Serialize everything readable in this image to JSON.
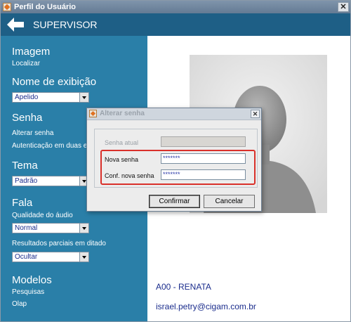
{
  "window": {
    "title": "Perfil do Usuário"
  },
  "header": {
    "title": "SUPERVISOR",
    "back_icon": "arrow-left-icon"
  },
  "sidebar": {
    "imagem": {
      "heading": "Imagem",
      "action": "Localizar"
    },
    "nome": {
      "heading": "Nome de exibição",
      "selected": "Apelido"
    },
    "senha": {
      "heading": "Senha",
      "alterar": "Alterar senha",
      "autenticacao": "Autenticação em duas e"
    },
    "tema": {
      "heading": "Tema",
      "selected": "Padrão"
    },
    "fala": {
      "heading": "Fala",
      "qualidade_label": "Qualidade do áudio",
      "qualidade_selected": "Normal",
      "parciais_label": "Resultados parciais em ditado",
      "parciais_selected": "Ocultar"
    },
    "modelos": {
      "heading": "Modelos",
      "items": [
        "Pesquisas",
        "Olap"
      ]
    }
  },
  "profile": {
    "name": "A00 - RENATA",
    "email": "israel.petry@cigam.com.br",
    "photo_icon": "user-silhouette-icon"
  },
  "dialog": {
    "title": "Alterar senha",
    "senha_atual_label": "Senha atual",
    "senha_atual_value": "",
    "nova_senha_label": "Nova senha",
    "nova_senha_value": "*******",
    "conf_label": "Conf. nova senha",
    "conf_value": "*******",
    "confirm_label": "Confirmar",
    "cancel_label": "Cancelar"
  },
  "colors": {
    "header": "#1e5f86",
    "sidebar": "#2a7fa8",
    "highlight": "#d9302a",
    "link_text": "#1a2c8c"
  }
}
